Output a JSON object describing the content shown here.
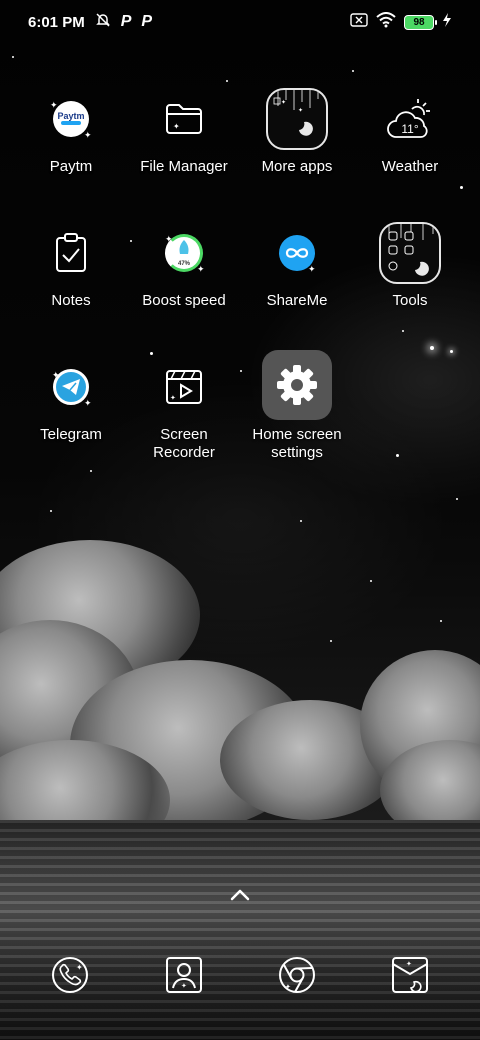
{
  "status_bar": {
    "time": "6:01 PM",
    "battery_level": "98",
    "icons": [
      "alarm-off-icon",
      "paytm-notification-icon",
      "paytm-notification-icon",
      "sim-absent-icon",
      "wifi-icon",
      "battery-icon",
      "charging-icon"
    ]
  },
  "apps": [
    {
      "label": "Paytm",
      "icon": "paytm-icon"
    },
    {
      "label": "File Manager",
      "icon": "folder-icon"
    },
    {
      "label": "More apps",
      "icon": "app-folder-icon"
    },
    {
      "label": "Weather",
      "icon": "weather-icon",
      "temperature": "11°"
    },
    {
      "label": "Notes",
      "icon": "clipboard-check-icon"
    },
    {
      "label": "Boost speed",
      "icon": "rocket-icon",
      "percent": "47%"
    },
    {
      "label": "ShareMe",
      "icon": "infinity-icon"
    },
    {
      "label": "Tools",
      "icon": "app-folder-icon"
    },
    {
      "label": "Telegram",
      "icon": "paper-plane-icon"
    },
    {
      "label": "Screen\nRecorder",
      "icon": "screen-recorder-icon"
    },
    {
      "label": "Home screen\nsettings",
      "icon": "gear-icon"
    }
  ],
  "dock": [
    {
      "name": "phone",
      "icon": "phone-icon"
    },
    {
      "name": "contacts",
      "icon": "contacts-icon"
    },
    {
      "name": "chrome",
      "icon": "chrome-icon"
    },
    {
      "name": "messages",
      "icon": "messages-icon"
    }
  ],
  "colors": {
    "battery": "#4cd964",
    "settings_tile": "#555555",
    "telegram": "#2aa3e0",
    "shareme": "#1fa3f2",
    "paytm_blue": "#1b3b8a"
  }
}
